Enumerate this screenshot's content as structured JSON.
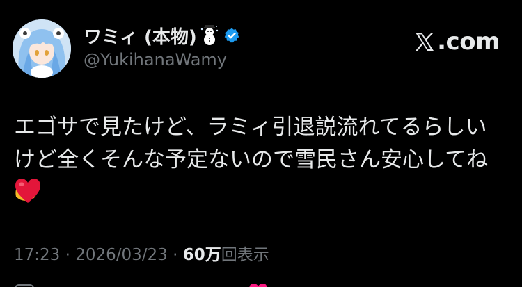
{
  "header": {
    "display_name": "ワミィ (本物)",
    "handle": "@YukihanaWamy",
    "source_label": ".com",
    "icons": {
      "name_emoji": "snowman-icon",
      "verified": "verified-badge-icon",
      "source_logo": "x-logo-icon"
    },
    "colors": {
      "verified": "#1d9bf0",
      "secondary_text": "#71767b",
      "primary_text": "#e7e9ea",
      "background": "#000000"
    }
  },
  "tweet": {
    "text": "エゴサで見たけど、ラミィ引退説流れてるらしいけど全くそんな予定ないので雪民さん安心してね",
    "trailing_emojis": [
      "heart-hands-icon",
      "red-heart-icon"
    ]
  },
  "meta": {
    "time": "17:23",
    "separator": " · ",
    "date": "2026/03/23",
    "views_count": "60万",
    "views_label": "回表示"
  }
}
